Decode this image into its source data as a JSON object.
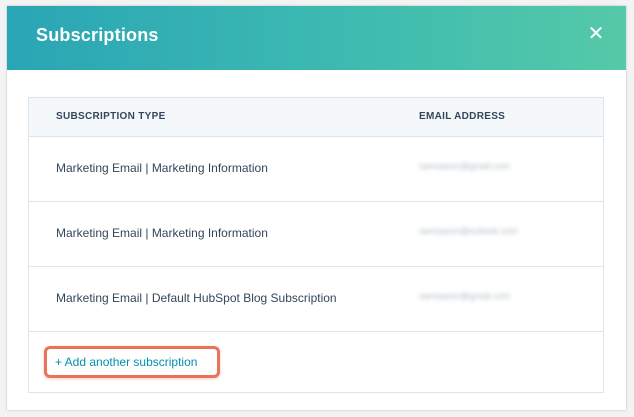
{
  "modal": {
    "title": "Subscriptions",
    "close_glyph": "✕"
  },
  "table": {
    "headers": {
      "subscription_type": "SUBSCRIPTION TYPE",
      "email_address": "EMAIL ADDRESS"
    },
    "rows": [
      {
        "type": "Marketing Email | Marketing Information",
        "email": "samsaxon@gmail.com"
      },
      {
        "type": "Marketing Email | Marketing Information",
        "email": "samsaxon@outlook.com"
      },
      {
        "type": "Marketing Email | Default HubSpot Blog Subscription",
        "email": "samsaxon@gmail.com"
      }
    ]
  },
  "actions": {
    "add_subscription": "+ Add another subscription"
  },
  "colors": {
    "header_gradient_start": "#2aa5b5",
    "header_gradient_end": "#55c9a8",
    "link": "#0091ae",
    "highlight": "#e8735a",
    "text": "#33475b"
  }
}
